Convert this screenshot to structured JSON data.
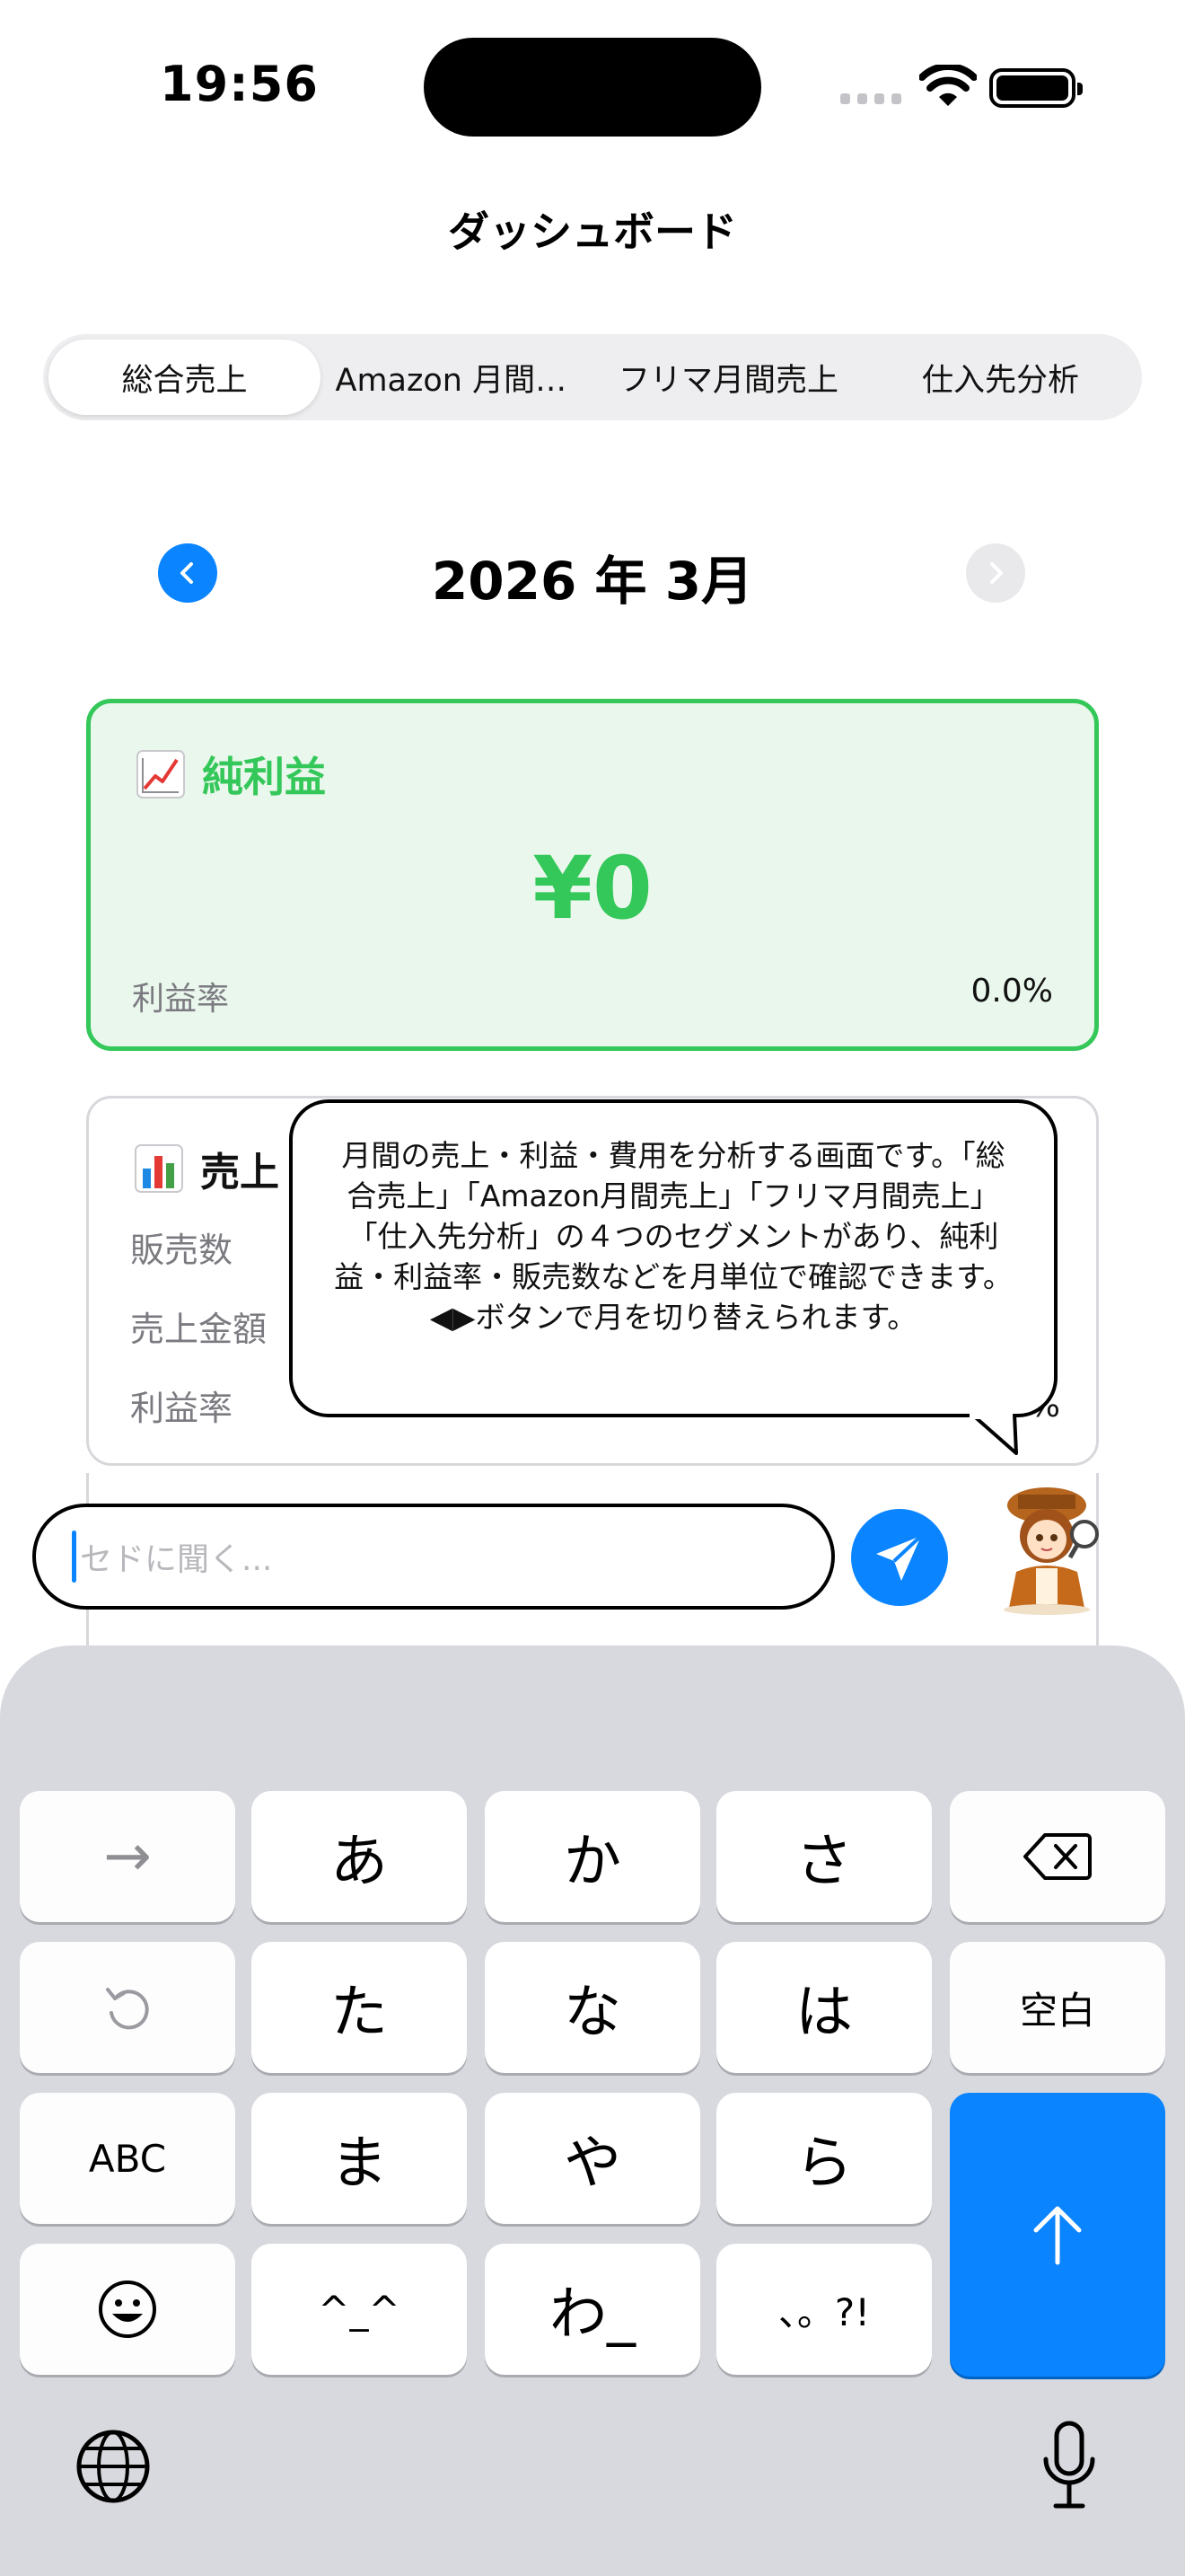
{
  "status_bar": {
    "time": "19:56"
  },
  "nav": {
    "title": "ダッシュボード"
  },
  "segments": [
    {
      "label": "総合売上",
      "selected": true
    },
    {
      "label": "Amazon 月間売上",
      "selected": false
    },
    {
      "label": "フリマ月間売上",
      "selected": false
    },
    {
      "label": "仕入先分析",
      "selected": false
    }
  ],
  "month": {
    "label": "2026 年 3月",
    "prev_icon": "chevron-left-icon",
    "next_icon": "chevron-right-icon"
  },
  "profit_card": {
    "icon": "chart-increasing-icon",
    "title": "純利益",
    "value": "¥0",
    "rate_label": "利益率",
    "rate_value": "0.0%",
    "accent_color": "#34c759"
  },
  "sales_card": {
    "icon": "bar-chart-icon",
    "title": "売上",
    "rows": [
      {
        "label": "販売数"
      },
      {
        "label": "売上金額"
      },
      {
        "label": "利益率"
      }
    ],
    "trailing_fragment": "%"
  },
  "bubble": {
    "text": "月間の売上・利益・費用を分析する画面です。「総合売上」「Amazon月間売上」「フリマ月間売上」「仕入先分析」の４つのセグメントがあり、純利益・利益率・販売数などを月単位で確認できます。◀▶ボタンで月を切り替えられます。"
  },
  "chat": {
    "placeholder": "セドに聞く...",
    "send_icon": "paper-plane-icon",
    "avatar_icon": "detective-girl-avatar"
  },
  "keyboard": {
    "keys": {
      "arrow": "→",
      "a": "あ",
      "ka": "か",
      "sa": "さ",
      "ta": "た",
      "na": "な",
      "ha": "は",
      "space": "空白",
      "abc": "ABC",
      "ma": "ま",
      "ya": "や",
      "ra": "ら",
      "emoticon": "^_^",
      "wa": "わ_",
      "punct": "、。?!"
    },
    "icons": [
      "backspace-icon",
      "undo-icon",
      "emoji-icon",
      "enter-arrow-up-icon",
      "globe-icon",
      "microphone-icon"
    ],
    "accent_color": "#0a84ff"
  }
}
